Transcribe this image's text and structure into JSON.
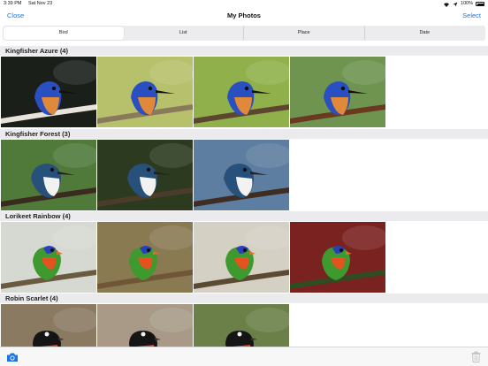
{
  "status": {
    "time": "3:39 PM",
    "date": "Sat Nov 23",
    "battery": "100%"
  },
  "nav": {
    "close_label": "Close",
    "title": "My Photos",
    "select_label": "Select"
  },
  "segments": [
    "Bird",
    "List",
    "Place",
    "Date"
  ],
  "active_segment": "Bird",
  "sections": [
    {
      "title": "Kingfisher Azure (4)",
      "photos": [
        {
          "bg": "#1a1f1a",
          "bird": "azure",
          "perch": "#e8e4dc"
        },
        {
          "bg": "#b7c06a",
          "bird": "azure",
          "perch": "#8a7a5c"
        },
        {
          "bg": "#8fb04a",
          "bird": "azure",
          "perch": "#5d4630"
        },
        {
          "bg": "#6f9450",
          "bird": "azure",
          "perch": "#6a3a20"
        }
      ]
    },
    {
      "title": "Kingfisher Forest (3)",
      "photos": [
        {
          "bg": "#4f7a3a",
          "bird": "forest",
          "perch": "#3b2a1f"
        },
        {
          "bg": "#2c3a20",
          "bird": "forest",
          "perch": "#4a3b2a"
        },
        {
          "bg": "#5d7ea0",
          "bird": "forest",
          "perch": "#3e2d22"
        }
      ]
    },
    {
      "title": "Lorikeet Rainbow (4)",
      "photos": [
        {
          "bg": "#d6d8d2",
          "bird": "lorikeet",
          "perch": "#6a5a40"
        },
        {
          "bg": "#8a7a52",
          "bird": "lorikeet",
          "perch": "#6e5636"
        },
        {
          "bg": "#d4d0c4",
          "bird": "lorikeet",
          "perch": "#5a4a34"
        },
        {
          "bg": "#7a2220",
          "bird": "lorikeet",
          "perch": "#2f4d20"
        }
      ]
    },
    {
      "title": "Robin Scarlet (4)",
      "photos": [
        {
          "bg": "#8a7a62",
          "bird": "robin",
          "perch": "#5a4530"
        },
        {
          "bg": "#a89a86",
          "bird": "robin",
          "perch": "#6a5640"
        },
        {
          "bg": "#6a8048",
          "bird": "robin",
          "perch": "#4a3a2a"
        }
      ]
    }
  ],
  "toolbar": {
    "left_icon": "camera-icon",
    "right_icon": "trash-icon"
  },
  "colors": {
    "accent": "#1a73e8",
    "section_bg": "#ebebed"
  }
}
